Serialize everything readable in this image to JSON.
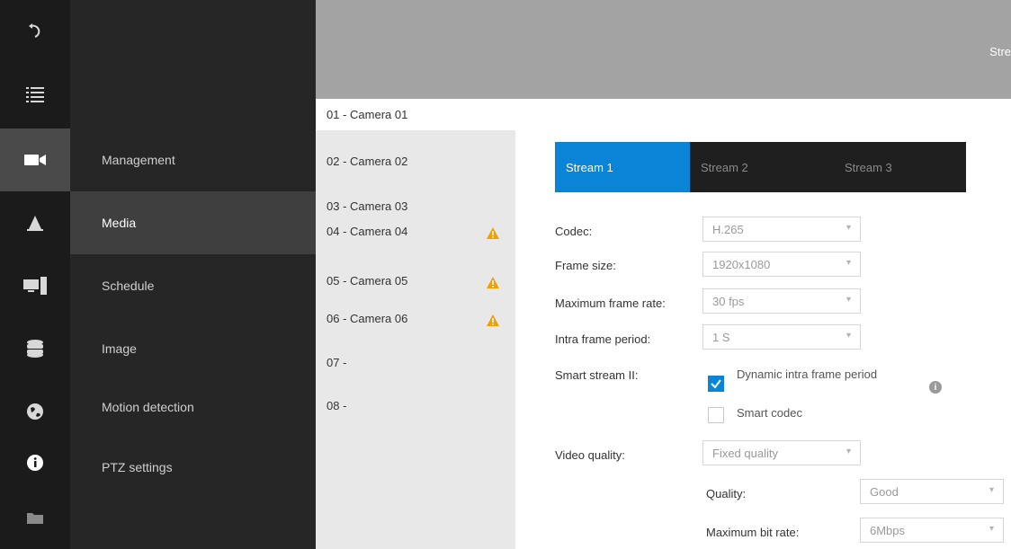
{
  "colors": {
    "accent": "#0a84d6",
    "rail_bg": "#1b1b1b",
    "submenu_bg": "#262626",
    "header_bg": "#a3a3a3",
    "warning": "#f0a000"
  },
  "rail": {
    "icons": [
      "back-arrow-icon",
      "list-icon",
      "video-camera-icon",
      "alarm-cone-icon",
      "devices-icon",
      "database-icon",
      "globe-icon",
      "info-icon",
      "folder-icon"
    ],
    "active_index": 2
  },
  "submenu": {
    "items": [
      {
        "label": "Management"
      },
      {
        "label": "Media",
        "active": true
      },
      {
        "label": "Schedule"
      },
      {
        "label": "Image"
      },
      {
        "label": "Motion detection"
      },
      {
        "label": "PTZ settings"
      }
    ]
  },
  "header": {
    "title": "Stre"
  },
  "cameras": [
    {
      "label": "01 - Camera 01",
      "selected": true,
      "warning": false
    },
    {
      "label": "02 - Camera 02",
      "warning": false
    },
    {
      "label": "03 - Camera 03",
      "warning": false
    },
    {
      "label": "04 - Camera 04",
      "warning": true
    },
    {
      "label": "05 - Camera 05",
      "warning": true
    },
    {
      "label": "06 - Camera 06",
      "warning": true
    },
    {
      "label": "07 -",
      "warning": false
    },
    {
      "label": "08 -",
      "warning": false
    }
  ],
  "tabs": [
    {
      "label": "Stream 1",
      "active": true
    },
    {
      "label": "Stream 2"
    },
    {
      "label": "Stream 3"
    }
  ],
  "form": {
    "codec": {
      "label": "Codec:",
      "value": "H.265"
    },
    "frame_size": {
      "label": "Frame size:",
      "value": "1920x1080"
    },
    "max_frame_rate": {
      "label": "Maximum frame rate:",
      "value": "30 fps"
    },
    "intra_frame_period": {
      "label": "Intra frame period:",
      "value": "1 S"
    },
    "smart_stream": {
      "label": "Smart stream II:",
      "dynamic_label": "Dynamic intra frame period",
      "dynamic_checked": true,
      "smart_codec_label": "Smart codec",
      "smart_codec_checked": false
    },
    "video_quality": {
      "label": "Video quality:",
      "value": "Fixed quality"
    },
    "quality": {
      "label": "Quality:",
      "value": "Good"
    },
    "max_bit_rate": {
      "label": "Maximum bit rate:",
      "value": "6Mbps"
    }
  }
}
